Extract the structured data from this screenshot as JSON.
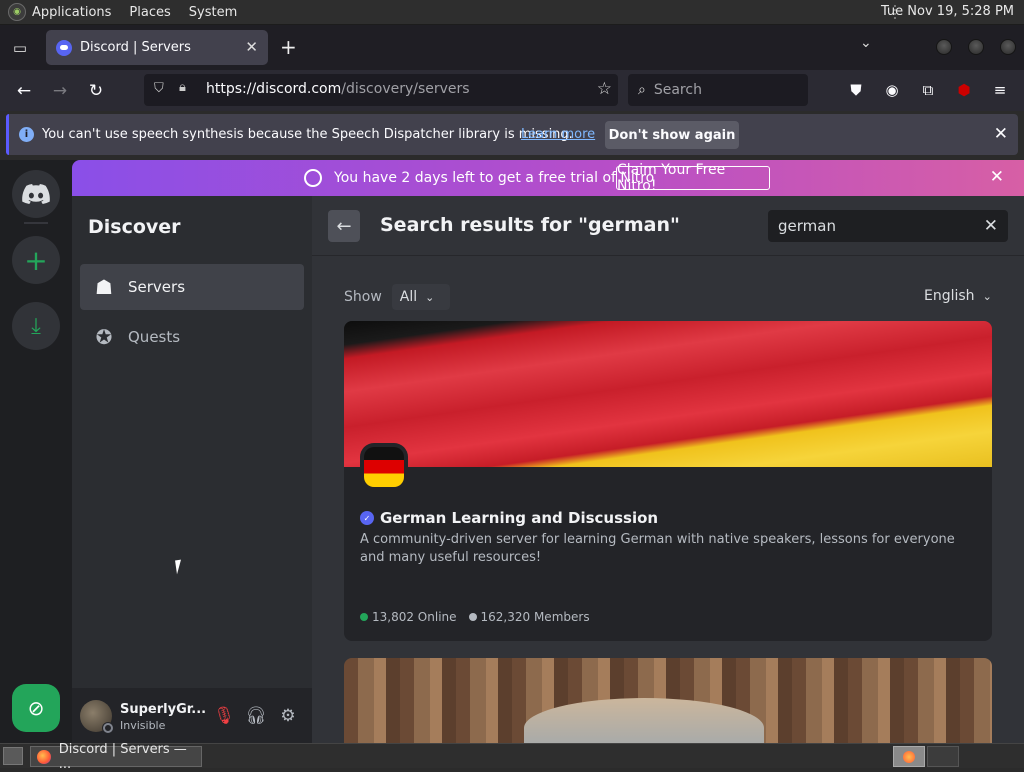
{
  "system": {
    "menus": [
      "Applications",
      "Places",
      "System"
    ],
    "clock": "Tue Nov 19,  5:28 PM"
  },
  "browser": {
    "tab_title": "Discord | Servers",
    "url_host": "https://discord.com",
    "url_path": "/discovery/servers",
    "search_placeholder": "Search",
    "notification": {
      "message": "You can't use speech synthesis because the Speech Dispatcher library is missing.",
      "learn_more": "Learn more",
      "dont_show": "Don't show again"
    }
  },
  "nitro": {
    "text": "You have 2 days left to get a free trial of Nitro",
    "claim": "Claim Your Free Nitro!"
  },
  "sidebar": {
    "title": "Discover",
    "items": [
      {
        "label": "Servers",
        "icon": "servers-icon"
      },
      {
        "label": "Quests",
        "icon": "quests-icon"
      }
    ]
  },
  "user": {
    "name": "SuperlyGr...",
    "status": "Invisible"
  },
  "main": {
    "title": "Search results for \"german\"",
    "search_value": "german",
    "show_label": "Show",
    "show_value": "All",
    "language": "English"
  },
  "results": [
    {
      "name": "German Learning and Discussion",
      "description": "A community-driven server for learning German with native speakers, lessons for everyone and many useful resources!",
      "online": "13,802 Online",
      "members": "162,320 Members"
    }
  ],
  "taskbar": {
    "task_title": "Discord | Servers — ..."
  },
  "colors": {
    "blurple": "#5865f2",
    "online": "#23a55a",
    "nitro_start": "#8a4fe8",
    "nitro_end": "#d75fa5"
  }
}
